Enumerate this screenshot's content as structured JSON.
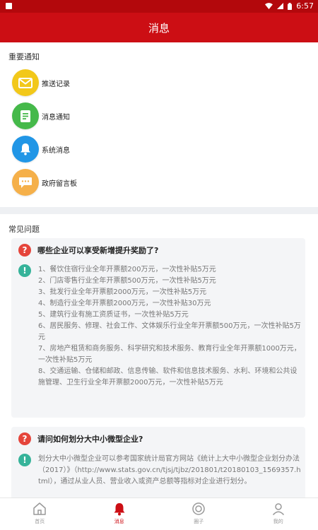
{
  "status_bar": {
    "time": "6:57"
  },
  "header": {
    "title": "消息"
  },
  "important": {
    "title": "重要通知",
    "items": [
      {
        "label": "推送记录",
        "icon": "envelope-icon",
        "color": "#f2c81a"
      },
      {
        "label": "消息通知",
        "icon": "document-icon",
        "color": "#45b94a"
      },
      {
        "label": "系统消息",
        "icon": "bell-icon",
        "color": "#2196e6"
      },
      {
        "label": "政府留言板",
        "icon": "chat-icon",
        "color": "#f5b04a"
      }
    ]
  },
  "faq": {
    "title": "常见问题",
    "items": [
      {
        "question": "哪些企业可以享受新增提升奖励了?",
        "answer_lines": [
          "1、餐饮住宿行业全年开票额200万元，一次性补贴5万元",
          "2、门店零售行业全年开票额500万元，一次性补贴5万元",
          "3、批发行业全年开票额2000万元，一次性补贴5万元",
          "4、制造行业全年开票额2000万元，一次性补贴30万元",
          "5、建筑行业有施工资质证书，一次性补贴5万元",
          "6、居民服务、修理、社会工作、文体娱乐行业全年开票额500万元，一次性补贴5万元",
          "7、房地产租赁和商务服务、科学研究和技术服务、教育行业全年开票额1000万元，一次性补贴5万元",
          "8、交通运输、仓储和邮政、信息传输、软件和信息技术服务、水利、环境和公共设施管理、卫生行业全年开票额2000万元，一次性补贴5万元"
        ]
      },
      {
        "question": "请问如何划分大中小微型企业?",
        "answer_text": "划分大中小微型企业可以参考国家统计局官方网站《统计上大中小微型企业划分办法（2017）》（http://www.stats.gov.cn/tjsj/tjbz/201801/t20180103_1569357.html），通过从业人员、营业收入或资产总额等指标对企业进行划分。"
      }
    ]
  },
  "tabs": [
    {
      "label": "首页",
      "icon": "home-icon",
      "active": false
    },
    {
      "label": "消息",
      "icon": "bell-icon",
      "active": true
    },
    {
      "label": "圈子",
      "icon": "circle-icon",
      "active": false
    },
    {
      "label": "我的",
      "icon": "user-icon",
      "active": false
    }
  ],
  "colors": {
    "primary": "#cc0e14",
    "status_bar": "#b3080c",
    "question": "#e5453b",
    "answer": "#36b39a"
  }
}
